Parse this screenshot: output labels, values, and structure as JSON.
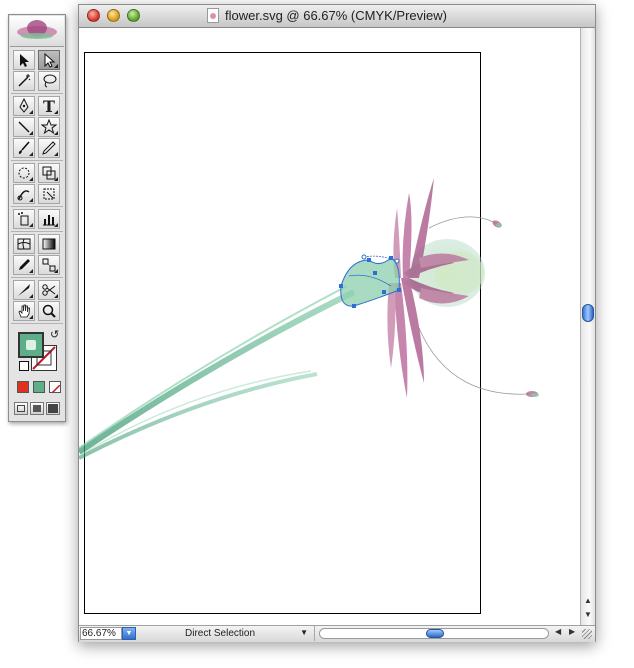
{
  "window": {
    "title": "flower.svg @ 66.67% (CMYK/Preview)"
  },
  "statusbar": {
    "zoom": "66.67%",
    "current_tool": "Direct Selection"
  },
  "icons": {
    "selection": "selection-arrow-icon",
    "direct_selection": "direct-selection-arrow-icon",
    "type": "T"
  },
  "colors": {
    "fill_swatch": "#5fae8a",
    "stroke_swatch": "#ffffff",
    "color_red": "#e0301e",
    "selection_blue": "#2f6fd0"
  }
}
